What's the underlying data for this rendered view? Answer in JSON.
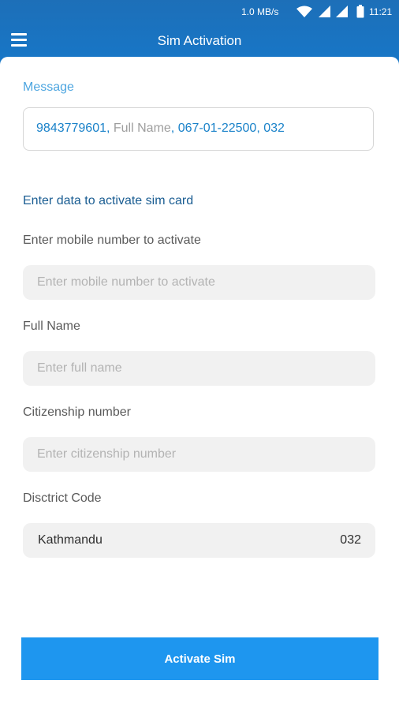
{
  "status_bar": {
    "network_speed": "1.0 MB/s",
    "time": "11:21",
    "icons": [
      "wifi-icon",
      "signal-icon",
      "signal-icon",
      "battery-icon"
    ]
  },
  "app_bar": {
    "title": "Sim Activation",
    "menu_icon": "hamburger-menu-icon"
  },
  "message": {
    "label": "Message",
    "parts": {
      "p1": "9843779601,",
      "p2": " Full Name",
      "p3": ", 067-01-22500, 032"
    }
  },
  "form": {
    "title": "Enter data to activate sim card",
    "mobile": {
      "label": "Enter mobile number to activate",
      "placeholder": "Enter mobile number to activate",
      "value": ""
    },
    "full_name": {
      "label": "Full Name",
      "placeholder": "Enter full name",
      "value": ""
    },
    "citizenship": {
      "label": "Citizenship number",
      "placeholder": "Enter citizenship number",
      "value": ""
    },
    "district": {
      "label": "Disctrict Code",
      "selected_name": "Kathmandu",
      "selected_code": "032"
    }
  },
  "actions": {
    "activate_label": "Activate Sim"
  },
  "colors": {
    "header": "#1777c8",
    "accent": "#1e96ef",
    "message_label": "#4ea6e0",
    "section_title": "#1a5d92"
  }
}
